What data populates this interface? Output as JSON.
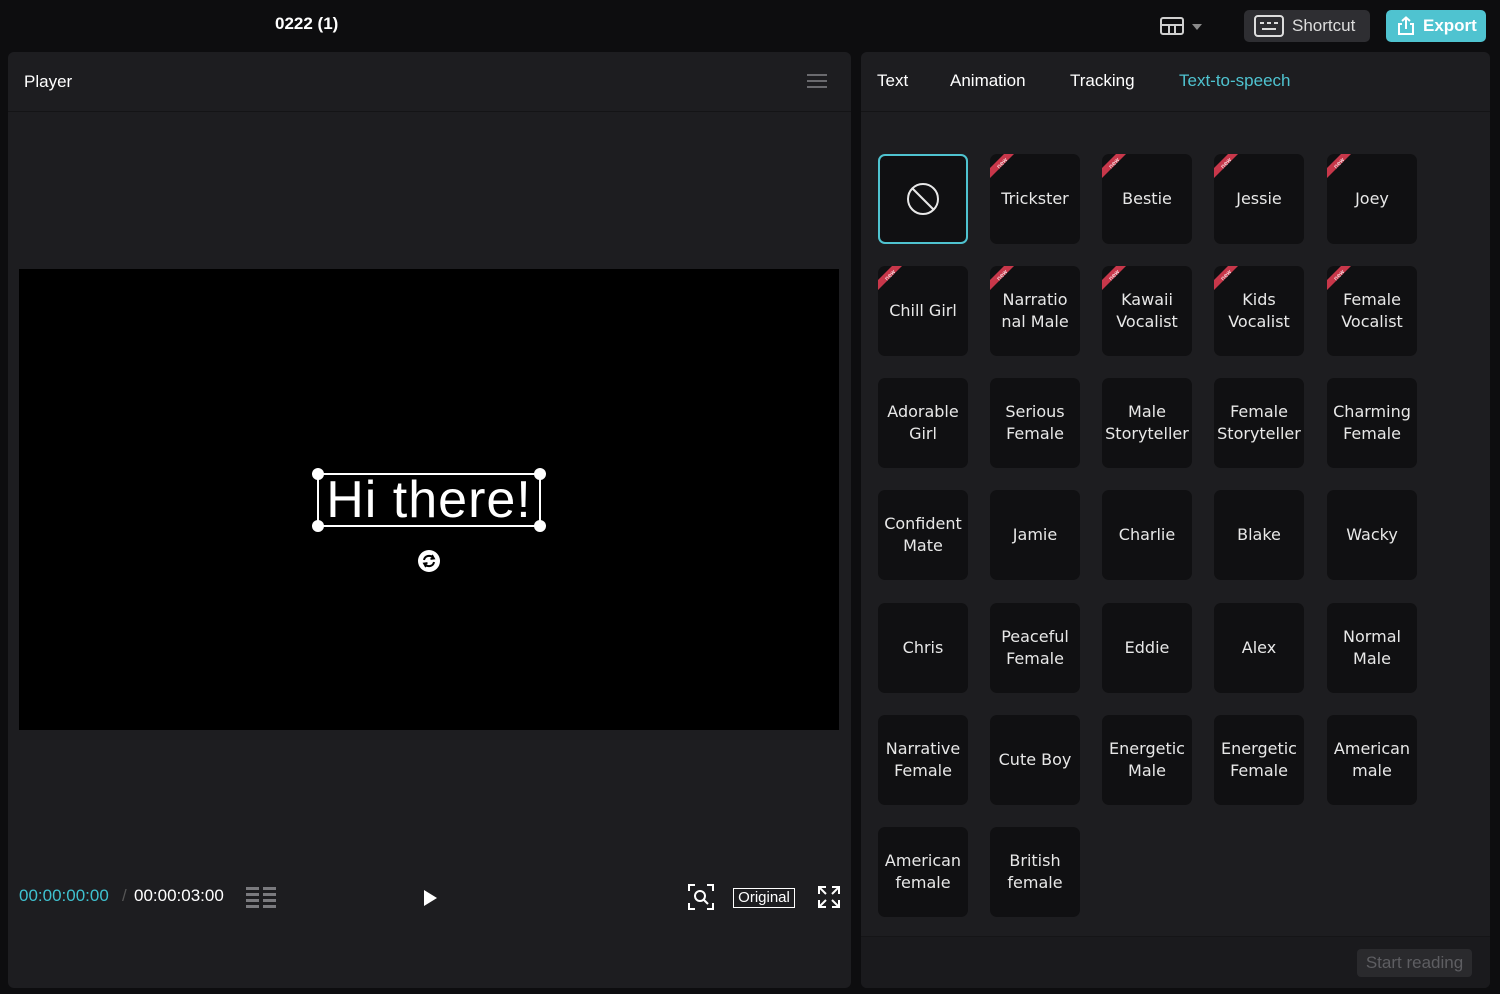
{
  "topbar": {
    "project_title": "0222 (1)",
    "layout_icon": "layout-grid-icon",
    "shortcut_label": "Shortcut",
    "export_label": "Export"
  },
  "player": {
    "title": "Player",
    "overlay_text": "Hi there!",
    "time_current": "00:00:00:00",
    "time_separator": "/",
    "time_total": "00:00:03:00",
    "original_label": "Original"
  },
  "tabs": [
    {
      "label": "Text",
      "active": false
    },
    {
      "label": "Animation",
      "active": false
    },
    {
      "label": "Tracking",
      "active": false
    },
    {
      "label": "Text-to-speech",
      "active": true
    }
  ],
  "voices": [
    {
      "label": "",
      "type": "none",
      "selected": true,
      "new": false
    },
    {
      "label": "Trickster",
      "new": true
    },
    {
      "label": "Bestie",
      "new": true
    },
    {
      "label": "Jessie",
      "new": true
    },
    {
      "label": "Joey",
      "new": true
    },
    {
      "label": "Chill Girl",
      "new": true
    },
    {
      "label": "Narratio nal Male",
      "new": true
    },
    {
      "label": "Kawaii Vocalist",
      "new": true
    },
    {
      "label": "Kids Vocalist",
      "new": true
    },
    {
      "label": "Female Vocalist",
      "new": true
    },
    {
      "label": "Adorable Girl",
      "new": false
    },
    {
      "label": "Serious Female",
      "new": false
    },
    {
      "label": "Male Storyteller",
      "new": false
    },
    {
      "label": "Female Storyteller",
      "new": false
    },
    {
      "label": "Charming Female",
      "new": false
    },
    {
      "label": "Confident Mate",
      "new": false
    },
    {
      "label": "Jamie",
      "new": false
    },
    {
      "label": "Charlie",
      "new": false
    },
    {
      "label": "Blake",
      "new": false
    },
    {
      "label": "Wacky",
      "new": false
    },
    {
      "label": "Chris",
      "new": false
    },
    {
      "label": "Peaceful Female",
      "new": false
    },
    {
      "label": "Eddie",
      "new": false
    },
    {
      "label": "Alex",
      "new": false
    },
    {
      "label": "Normal Male",
      "new": false
    },
    {
      "label": "Narrative Female",
      "new": false
    },
    {
      "label": "Cute Boy",
      "new": false
    },
    {
      "label": "Energetic Male",
      "new": false
    },
    {
      "label": "Energetic Female",
      "new": false
    },
    {
      "label": "American male",
      "new": false
    },
    {
      "label": "American female",
      "new": false
    },
    {
      "label": "British female",
      "new": false
    }
  ],
  "new_badge_text": "new",
  "start_reading_label": "Start reading",
  "colors": {
    "accent": "#4fc3d0",
    "panel_bg": "#1d1d20",
    "card_bg": "#101012",
    "badge": "#c8374a"
  }
}
